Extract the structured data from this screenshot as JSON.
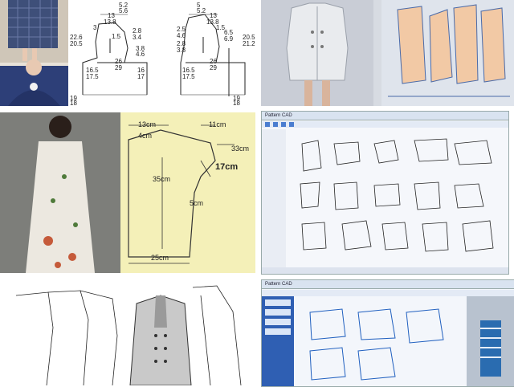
{
  "tiles": {
    "top_left_photos": {
      "alt": "dress photos"
    },
    "block_pattern": {
      "measurements_left": [
        "5.2",
        "5.6",
        "13",
        "13.8",
        "1.5",
        "3",
        "2.8",
        "3.4",
        "3.8",
        "4.6",
        "26",
        "29",
        "16.5",
        "17.5",
        "16",
        "17",
        "19",
        "18"
      ],
      "measurements_right": [
        "5",
        "5.2",
        "13",
        "13.8",
        "1.5",
        "2.5",
        "4.6",
        "2.8",
        "3.8",
        "6.5",
        "6.9",
        "26",
        "29",
        "16.5",
        "17.5",
        "19",
        "18"
      ],
      "side_left": [
        "22.6",
        "20.5"
      ],
      "side_right": [
        "20.5",
        "21.2"
      ]
    },
    "coat_3d": {},
    "yellow_pattern": {
      "labels": {
        "a": "13cm",
        "b": "4cm",
        "c": "11cm",
        "d": "33cm",
        "e": "17cm",
        "f": "35cm",
        "g": "5cm",
        "h": "25cm"
      }
    },
    "cad_software": {
      "title": "Pattern CAD"
    },
    "jacket_drawing": {},
    "cad_software_2": {
      "title": "Pattern CAD"
    }
  },
  "colors": {
    "yellow_bg": "#f4f0b8",
    "pattern_peach": "#f2c9a5",
    "cad_blue": "#1f5fbf",
    "line": "#222222"
  }
}
